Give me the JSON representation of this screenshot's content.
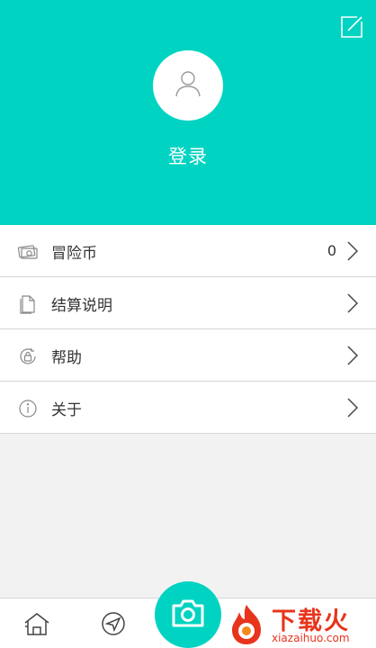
{
  "header": {
    "login_label": "登录",
    "bg_color": "#00d3c2",
    "edit_icon": "edit-icon",
    "avatar_icon": "user-icon"
  },
  "menu": {
    "items": [
      {
        "label": "冒险币",
        "value": "0",
        "icon": "money-icon"
      },
      {
        "label": "结算说明",
        "icon": "document-icon"
      },
      {
        "label": "帮助",
        "icon": "help-icon"
      },
      {
        "label": "关于",
        "icon": "info-icon"
      }
    ]
  },
  "tabbar": {
    "home_icon": "home-icon",
    "send_icon": "send-icon",
    "camera_icon": "camera-icon",
    "accent": "#00d3c2"
  },
  "watermark": {
    "title": "下载火",
    "url": "xiazaihuo.com",
    "color": "#e8341c"
  }
}
